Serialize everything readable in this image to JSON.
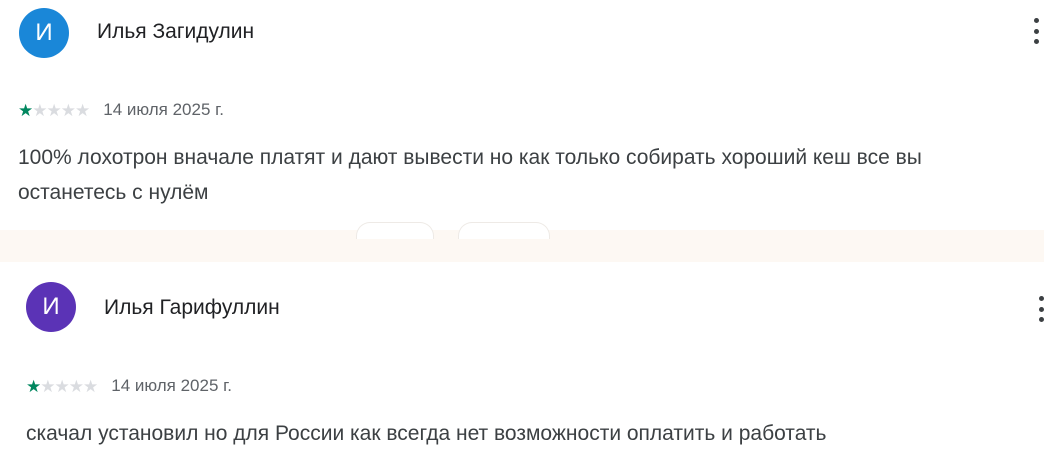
{
  "colors": {
    "star_filled": "#01875f",
    "star_empty": "#dadce0"
  },
  "reviews": [
    {
      "avatar_letter": "И",
      "avatar_color": "#1a87d8",
      "author": "Илья Загидулин",
      "rating": 1,
      "max_rating": 5,
      "date": "14 июля 2025 г.",
      "text": "100% лохотрон вначале платят и дают вывести но как только собирать хороший кеш все вы останетесь с нулём",
      "more_icon": "more-vert-icon"
    },
    {
      "avatar_letter": "И",
      "avatar_color": "#5b33b6",
      "author": "Илья Гарифуллин",
      "rating": 1,
      "max_rating": 5,
      "date": "14 июля 2025 г.",
      "text": "скачал установил но для России как всегда нет возможности оплатить и работать",
      "more_icon": "more-vert-icon"
    }
  ]
}
